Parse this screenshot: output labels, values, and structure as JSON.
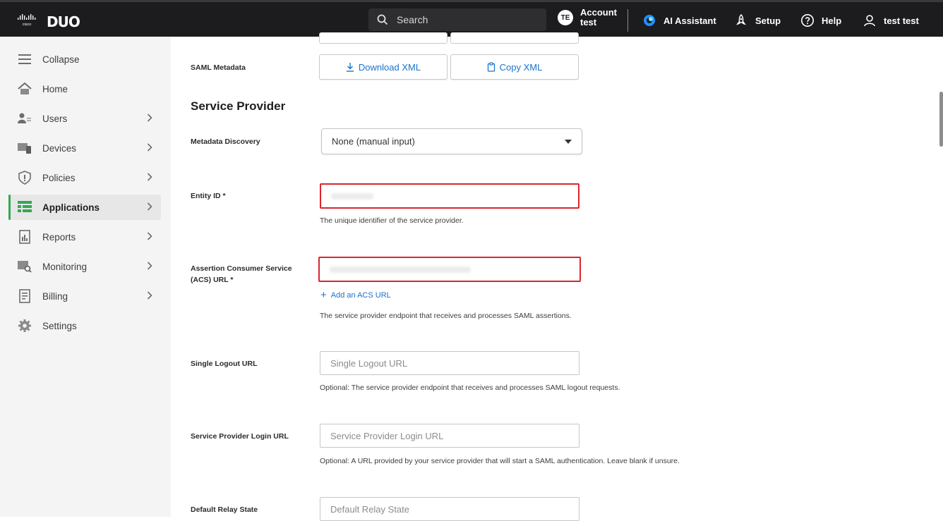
{
  "topbar": {
    "cisco_logo_text": "cisco",
    "duo_logo_text": "DUO",
    "search_placeholder": "Search",
    "account_badge": "TE",
    "account_line1": "Account",
    "account_line2": "test",
    "ai_assistant": "AI Assistant",
    "setup": "Setup",
    "help": "Help",
    "user_name": "test test"
  },
  "sidebar": {
    "items": [
      {
        "label": "Collapse",
        "icon": "collapse-icon"
      },
      {
        "label": "Home",
        "icon": "home-icon"
      },
      {
        "label": "Users",
        "icon": "users-icon"
      },
      {
        "label": "Devices",
        "icon": "devices-icon"
      },
      {
        "label": "Policies",
        "icon": "policies-icon"
      },
      {
        "label": "Applications",
        "icon": "applications-icon"
      },
      {
        "label": "Reports",
        "icon": "reports-icon"
      },
      {
        "label": "Monitoring",
        "icon": "monitoring-icon"
      },
      {
        "label": "Billing",
        "icon": "billing-icon"
      },
      {
        "label": "Settings",
        "icon": "settings-icon"
      }
    ],
    "active": "Applications",
    "accent": "#34a853"
  },
  "main": {
    "saml_metadata_label": "SAML Metadata",
    "download_xml": "Download XML",
    "copy_xml": "Copy XML",
    "section_title": "Service Provider",
    "metadata_discovery_label": "Metadata Discovery",
    "metadata_discovery_value": "None (manual input)",
    "entity_id_label": "Entity ID *",
    "entity_id_help": "The unique identifier of the service provider.",
    "acs_label_line1": "Assertion Consumer Service",
    "acs_label_line2": "(ACS) URL *",
    "add_acs": "Add an ACS URL",
    "acs_help": "The service provider endpoint that receives and processes SAML assertions.",
    "slo_label": "Single Logout URL",
    "slo_placeholder": "Single Logout URL",
    "slo_help": "Optional: The service provider endpoint that receives and processes SAML logout requests.",
    "sp_login_label": "Service Provider Login URL",
    "sp_login_placeholder": "Service Provider Login URL",
    "sp_login_help": "Optional: A URL provided by your service provider that will start a SAML authentication. Leave blank if unsure.",
    "relay_label": "Default Relay State",
    "relay_placeholder": "Default Relay State",
    "error_color": "#d9262c",
    "link_color": "#1a73c9"
  }
}
